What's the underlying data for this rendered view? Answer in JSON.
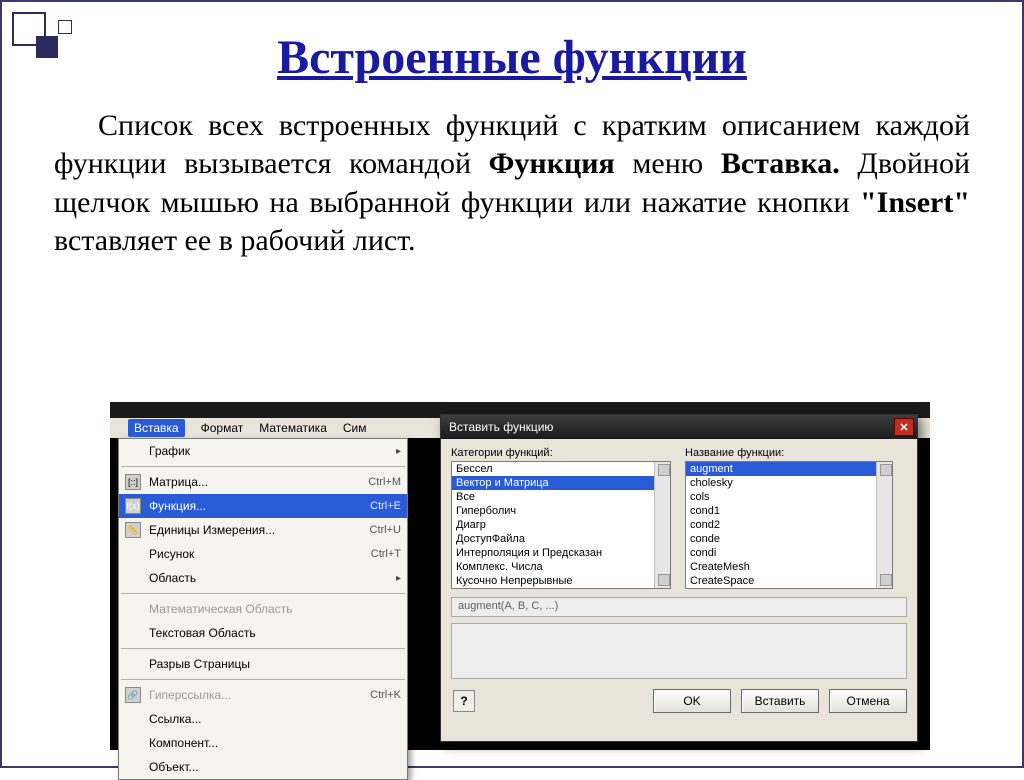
{
  "slide": {
    "title": "Встроенные функции",
    "paragraph_parts": {
      "t1": "Список всех встроенных функций с кратким описанием каждой функции вызывается командой ",
      "b1": "Функция",
      "t2": " меню ",
      "b2": "Вставка.",
      "t3": " Двойной щелчок мышью на выбранной функции или нажатие кнопки ",
      "b3": "\"Insert\"",
      "t4": " вставляет ее в рабочий лист."
    }
  },
  "menubar": {
    "items": [
      "Вставка",
      "Формат",
      "Математика",
      "Сим"
    ]
  },
  "dropdown": {
    "items": [
      {
        "label": "График",
        "arrow": true
      },
      {
        "label": "Матрица...",
        "shortcut": "Ctrl+M",
        "icon": "[::]"
      },
      {
        "label": "Функция...",
        "shortcut": "Ctrl+E",
        "icon": "f(x)",
        "selected": true
      },
      {
        "label": "Единицы Измерения...",
        "shortcut": "Ctrl+U",
        "icon": "📏"
      },
      {
        "label": "Рисунок",
        "shortcut": "Ctrl+T"
      },
      {
        "label": "Область",
        "arrow": true
      },
      {
        "label": "Математическая Область",
        "disabled": true
      },
      {
        "label": "Текстовая Область"
      },
      {
        "label": "Разрыв Страницы"
      },
      {
        "label": "Гиперссылка...",
        "shortcut": "Ctrl+K",
        "disabled": true,
        "icon": "🔗"
      },
      {
        "label": "Ссылка..."
      },
      {
        "label": "Компонент..."
      },
      {
        "label": "Объект..."
      }
    ],
    "separators_after": [
      0,
      5,
      7,
      8
    ]
  },
  "dialog": {
    "title": "Вставить функцию",
    "labels": {
      "categories": "Категории функций:",
      "names": "Название функции:"
    },
    "categories": [
      "Бессел",
      "Вектор и Матрица",
      "Все",
      "Гиперболич",
      "Диагр",
      "ДоступФайла",
      "Интерполяция и Предсказан",
      "Комплекс. Числа",
      "Кусочно Непрерывные"
    ],
    "categories_selected_index": 1,
    "functions": [
      "augment",
      "cholesky",
      "cols",
      "cond1",
      "cond2",
      "conde",
      "condi",
      "CreateMesh",
      "CreateSpace"
    ],
    "functions_selected_index": 0,
    "formula": "augment(A, B, C, ...)",
    "buttons": {
      "help": "?",
      "ok": "OK",
      "insert": "Вставить",
      "cancel": "Отмена"
    }
  }
}
